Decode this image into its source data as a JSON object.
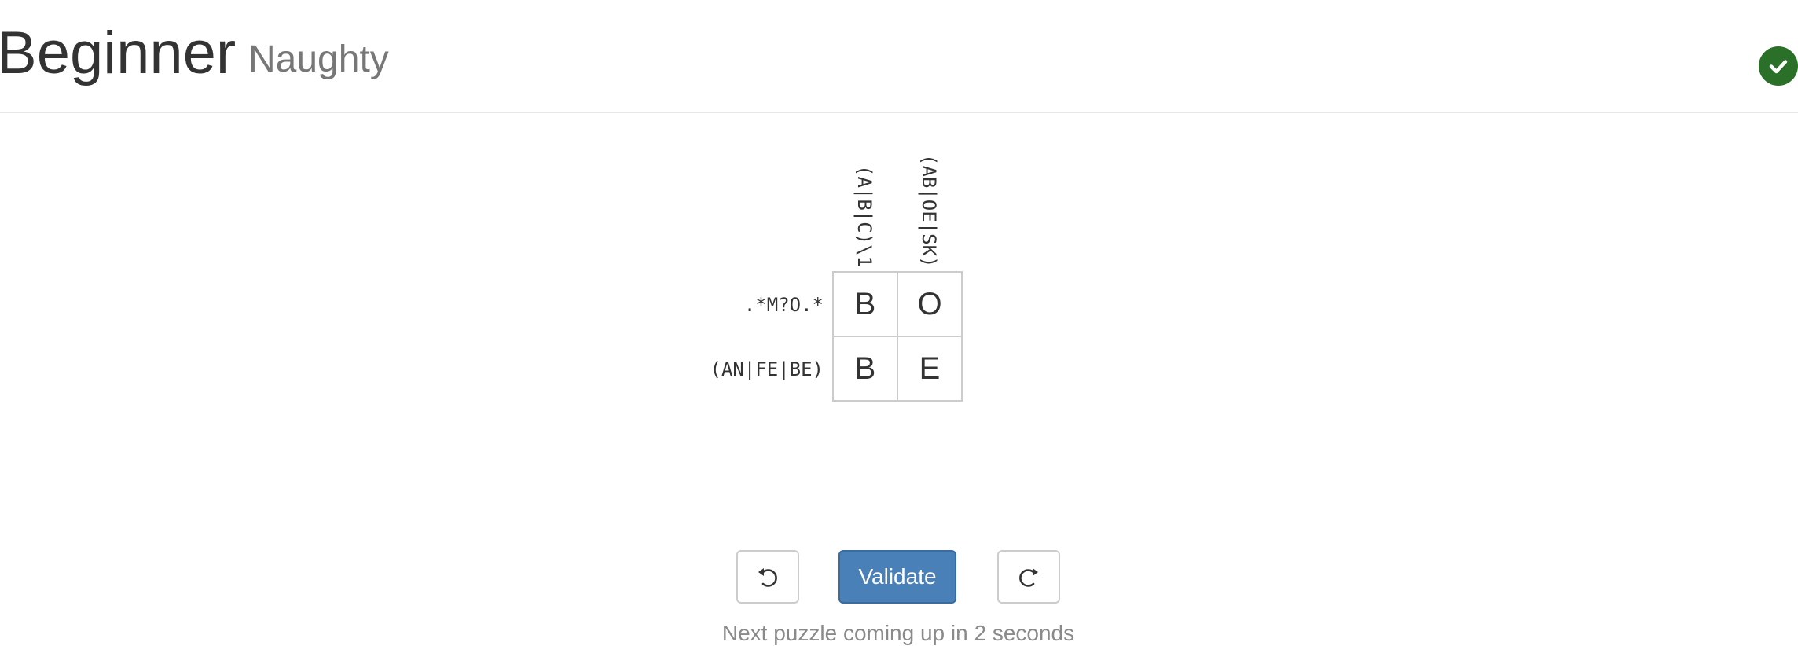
{
  "header": {
    "title": "Beginner",
    "subtitle": "Naughty",
    "status_icon": "check-circle-icon",
    "status_color": "#2b7028"
  },
  "puzzle": {
    "column_clues": [
      "(A|B|C)\\1",
      "(AB|OE|SK)"
    ],
    "row_clues": [
      ".*M?O.*",
      "(AN|FE|BE)"
    ],
    "cells": [
      [
        "B",
        "O"
      ],
      [
        "B",
        "E"
      ]
    ]
  },
  "controls": {
    "undo_icon": "undo-icon",
    "validate_label": "Validate",
    "redo_icon": "redo-icon",
    "accent_color": "#4a80b8"
  },
  "status": {
    "message": "Next puzzle coming up in 2 seconds"
  }
}
